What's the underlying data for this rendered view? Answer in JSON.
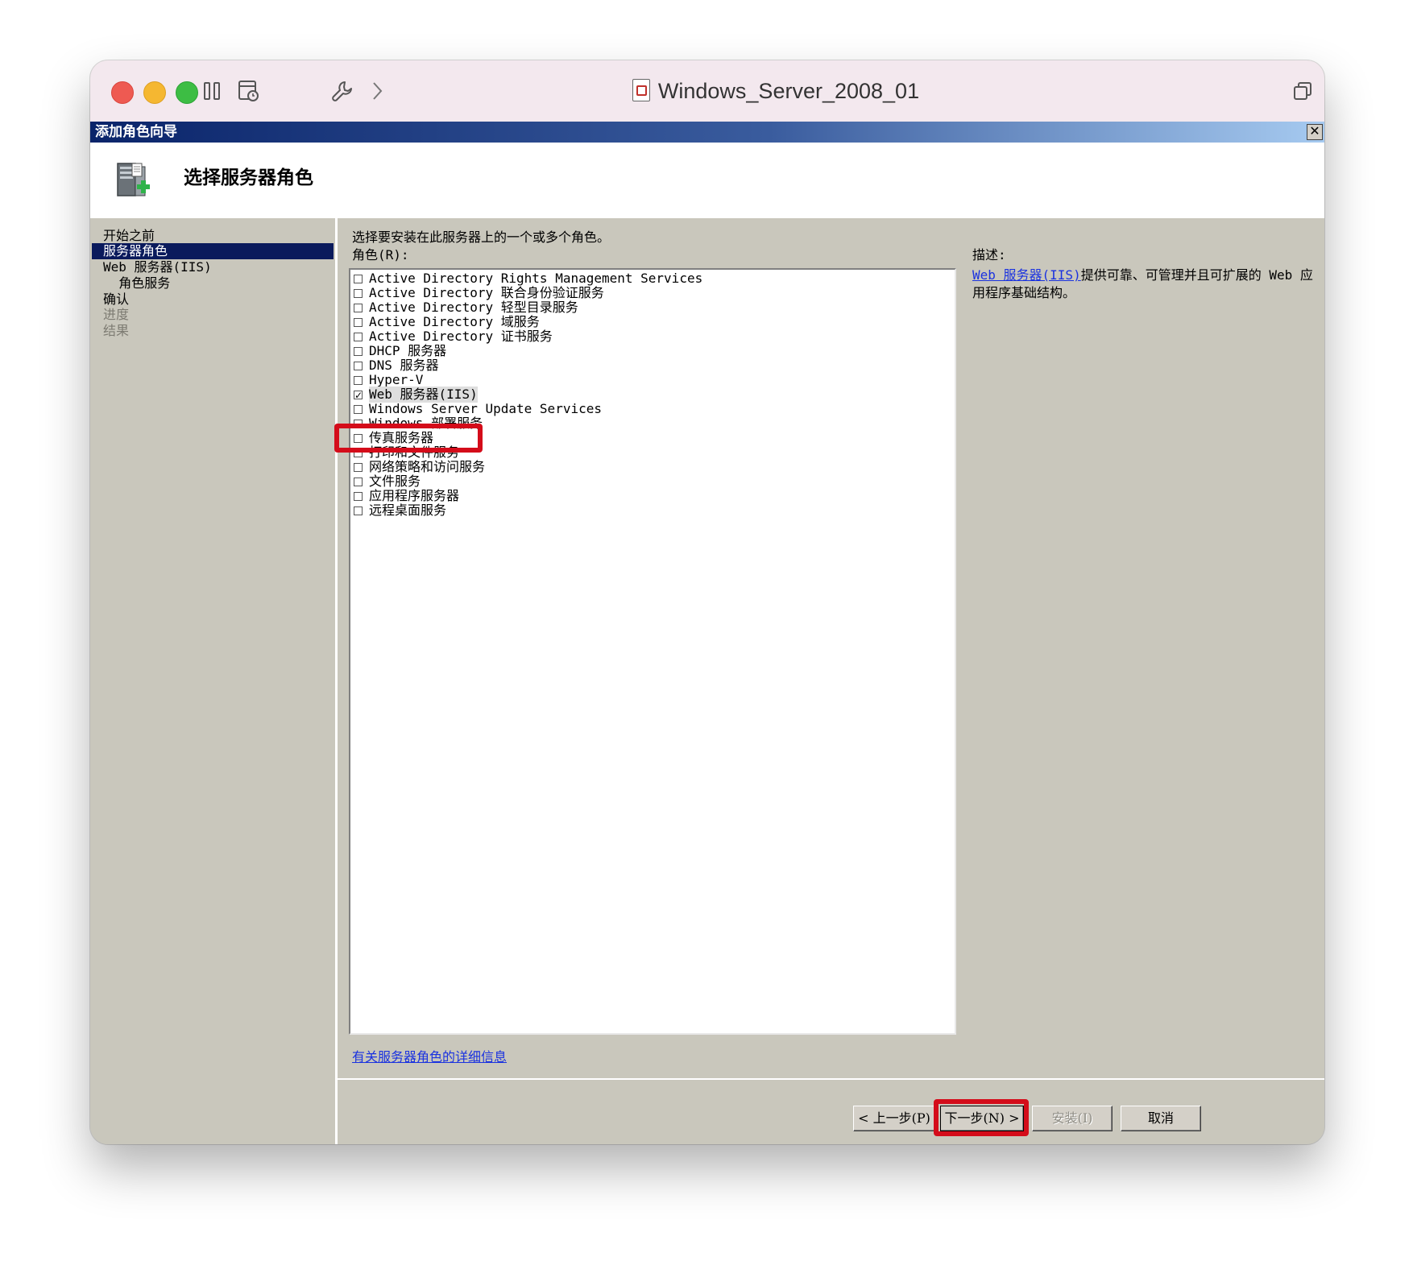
{
  "mac_window": {
    "title": "Windows_Server_2008_01"
  },
  "wizard": {
    "title": "添加角色向导",
    "close_glyph": "✕",
    "heading": "选择服务器角色"
  },
  "nav": {
    "items": [
      {
        "label": "开始之前",
        "state": "normal"
      },
      {
        "label": "服务器角色",
        "state": "selected"
      },
      {
        "label": "Web 服务器(IIS)",
        "state": "normal"
      },
      {
        "label": "  角色服务",
        "state": "normal"
      },
      {
        "label": "确认",
        "state": "normal"
      },
      {
        "label": "进度",
        "state": "disabled"
      },
      {
        "label": "结果",
        "state": "disabled"
      }
    ]
  },
  "main": {
    "instruction": "选择要安装在此服务器上的一个或多个角色。",
    "roles_label": "角色(R):",
    "roles": [
      {
        "label": "Active Directory Rights Management Services",
        "checked": false
      },
      {
        "label": "Active Directory 联合身份验证服务",
        "checked": false
      },
      {
        "label": "Active Directory 轻型目录服务",
        "checked": false
      },
      {
        "label": "Active Directory 域服务",
        "checked": false
      },
      {
        "label": "Active Directory 证书服务",
        "checked": false
      },
      {
        "label": "DHCP 服务器",
        "checked": false
      },
      {
        "label": "DNS 服务器",
        "checked": false
      },
      {
        "label": "Hyper-V",
        "checked": false
      },
      {
        "label": "Web 服务器(IIS)",
        "checked": true
      },
      {
        "label": "Windows Server Update Services",
        "checked": false
      },
      {
        "label": "Windows 部署服务",
        "checked": false
      },
      {
        "label": "传真服务器",
        "checked": false
      },
      {
        "label": "打印和文件服务",
        "checked": false
      },
      {
        "label": "网络策略和访问服务",
        "checked": false
      },
      {
        "label": "文件服务",
        "checked": false
      },
      {
        "label": "应用程序服务器",
        "checked": false
      },
      {
        "label": "远程桌面服务",
        "checked": false
      }
    ],
    "description_label": "描述:",
    "description_link": "Web 服务器(IIS)",
    "description_text": "提供可靠、可管理并且可扩展的 Web 应用程序基础结构。",
    "more_info_link": "有关服务器角色的详细信息"
  },
  "buttons": {
    "back": "< 上一步(P)",
    "next": "下一步(N) >",
    "install": "安装(I)",
    "cancel": "取消"
  },
  "colors": {
    "highlight": "#d40c1a",
    "nav_selected": "#0a1a5c",
    "link": "#1a32e0",
    "dialog_bg": "#c9c7bc"
  }
}
